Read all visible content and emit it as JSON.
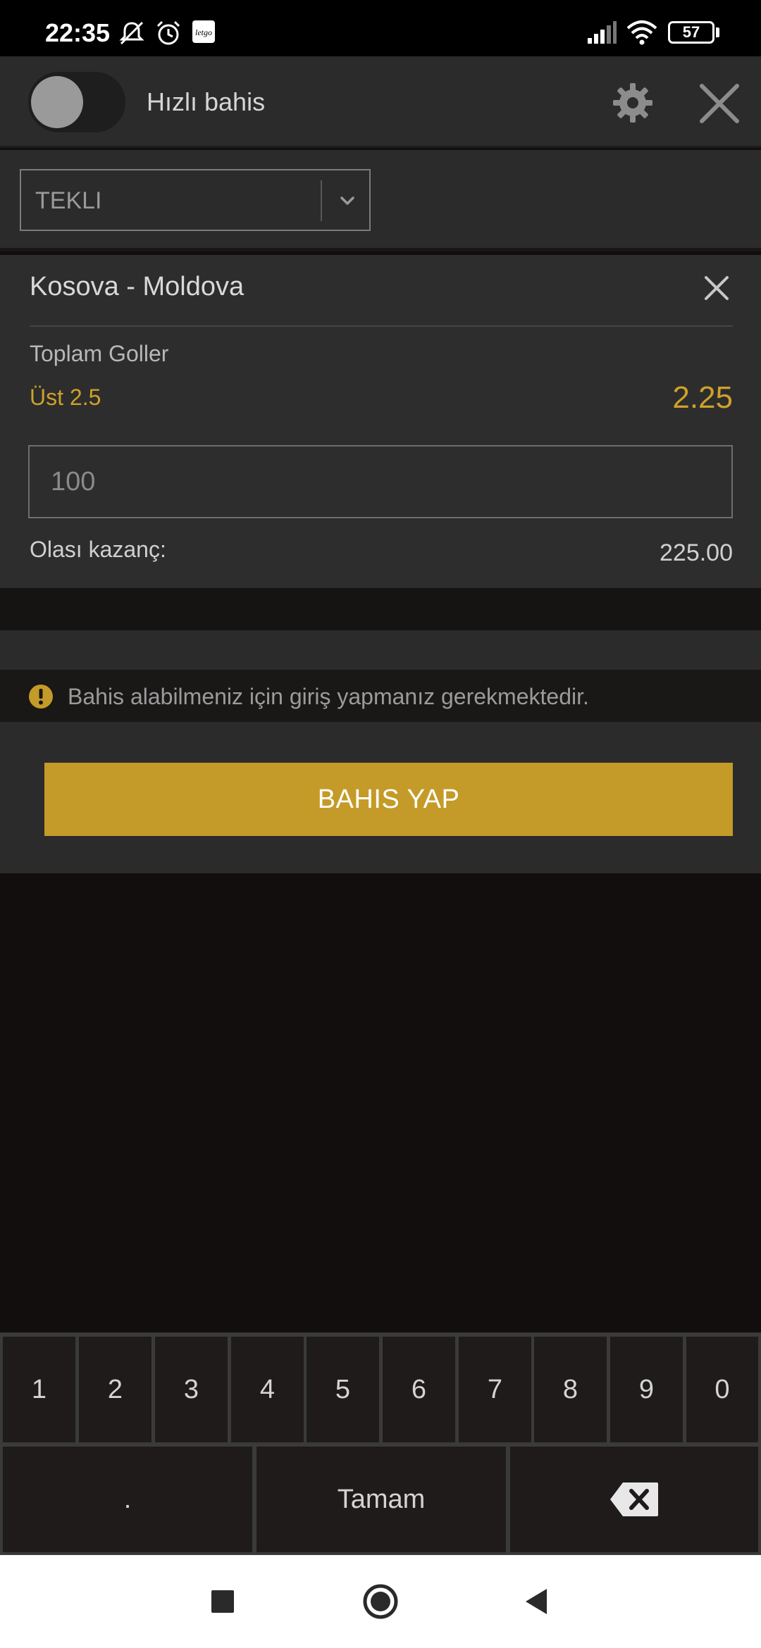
{
  "status_bar": {
    "time": "22:35",
    "battery": "57"
  },
  "header": {
    "toggle_label": "Hızlı bahis",
    "toggle_on": false
  },
  "bet_type": {
    "selected": "TEKLI"
  },
  "bet": {
    "match": "Kosova - Moldova",
    "market": "Toplam Goller",
    "selection": "Üst 2.5",
    "odds": "2.25",
    "stake_placeholder": "100",
    "potential_win_label": "Olası kazanç:",
    "potential_win_value": "225.00"
  },
  "warning": {
    "text": "Bahis alabilmeniz için giriş yapmanız gerekmektedir."
  },
  "action": {
    "place_bet_label": "BAHIS YAP"
  },
  "keyboard": {
    "digits": [
      "1",
      "2",
      "3",
      "4",
      "5",
      "6",
      "7",
      "8",
      "9",
      "0"
    ],
    "dot": ".",
    "done": "Tamam"
  },
  "colors": {
    "accent": "#c49b28",
    "odds": "#cfa129",
    "panel": "#2d2d2d",
    "background": "#110e0d"
  }
}
